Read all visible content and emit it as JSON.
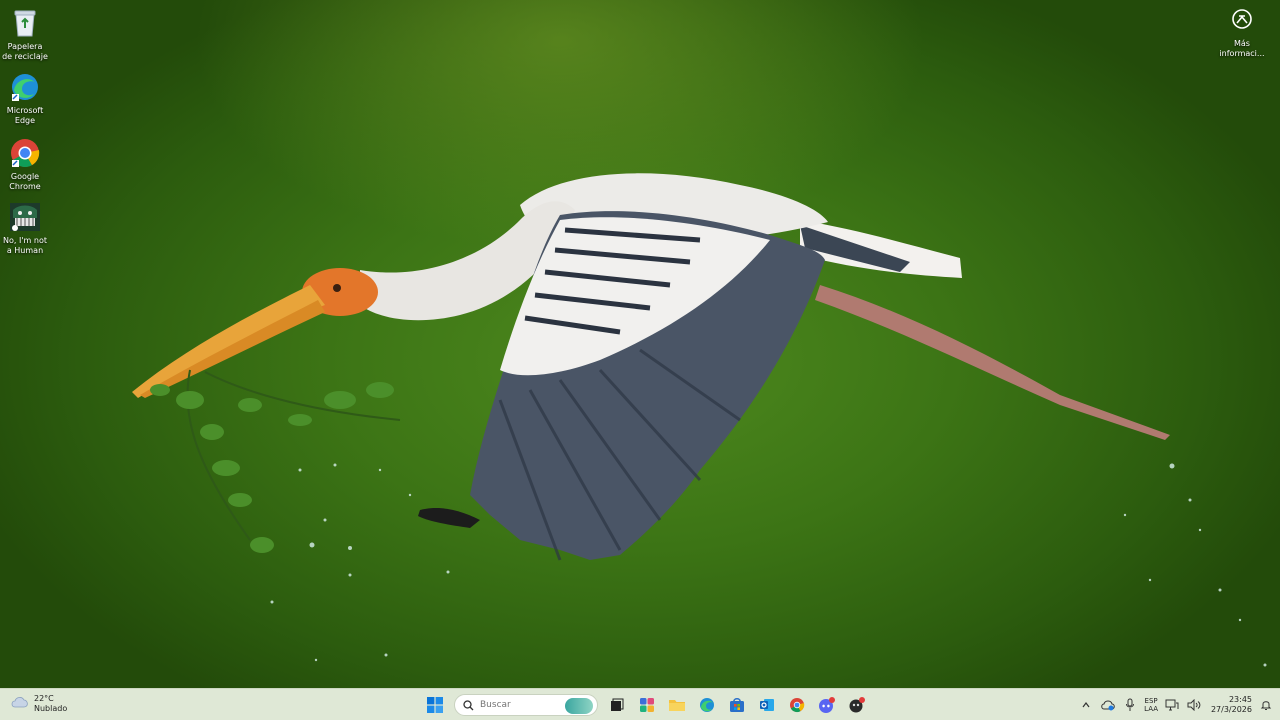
{
  "desktop": {
    "icons": [
      {
        "label": "Papelera de reciclaje",
        "icon": "recycle-bin-icon"
      },
      {
        "label": "Microsoft Edge",
        "icon": "edge-icon"
      },
      {
        "label": "Google Chrome",
        "icon": "chrome-icon"
      },
      {
        "label": "No, I'm not a Human",
        "icon": "game-icon"
      }
    ],
    "more_info": {
      "label": "Más informaci...",
      "icon": "info-circle-icon"
    }
  },
  "taskbar": {
    "weather": {
      "temp": "22°C",
      "condition": "Nublado",
      "icon": "cloud-icon"
    },
    "search": {
      "placeholder": "Buscar"
    },
    "apps": [
      {
        "name": "start",
        "icon": "windows-start-icon"
      },
      {
        "name": "task-view",
        "icon": "task-view-icon"
      },
      {
        "name": "widgets",
        "icon": "widgets-icon"
      },
      {
        "name": "file-explorer",
        "icon": "folder-icon"
      },
      {
        "name": "edge",
        "icon": "edge-icon"
      },
      {
        "name": "store",
        "icon": "store-icon"
      },
      {
        "name": "outlook",
        "icon": "outlook-icon"
      },
      {
        "name": "chrome",
        "icon": "chrome-icon"
      },
      {
        "name": "discord",
        "icon": "discord-icon"
      },
      {
        "name": "game",
        "icon": "game-icon"
      }
    ],
    "tray": {
      "lang_top": "ESP",
      "lang_bottom": "LAA",
      "time": "23:45",
      "date": "27/3/2026"
    }
  },
  "colors": {
    "wallpaper": "#3c7415",
    "taskbar": "#dfe8d6",
    "start_blue": "#0078d4"
  }
}
